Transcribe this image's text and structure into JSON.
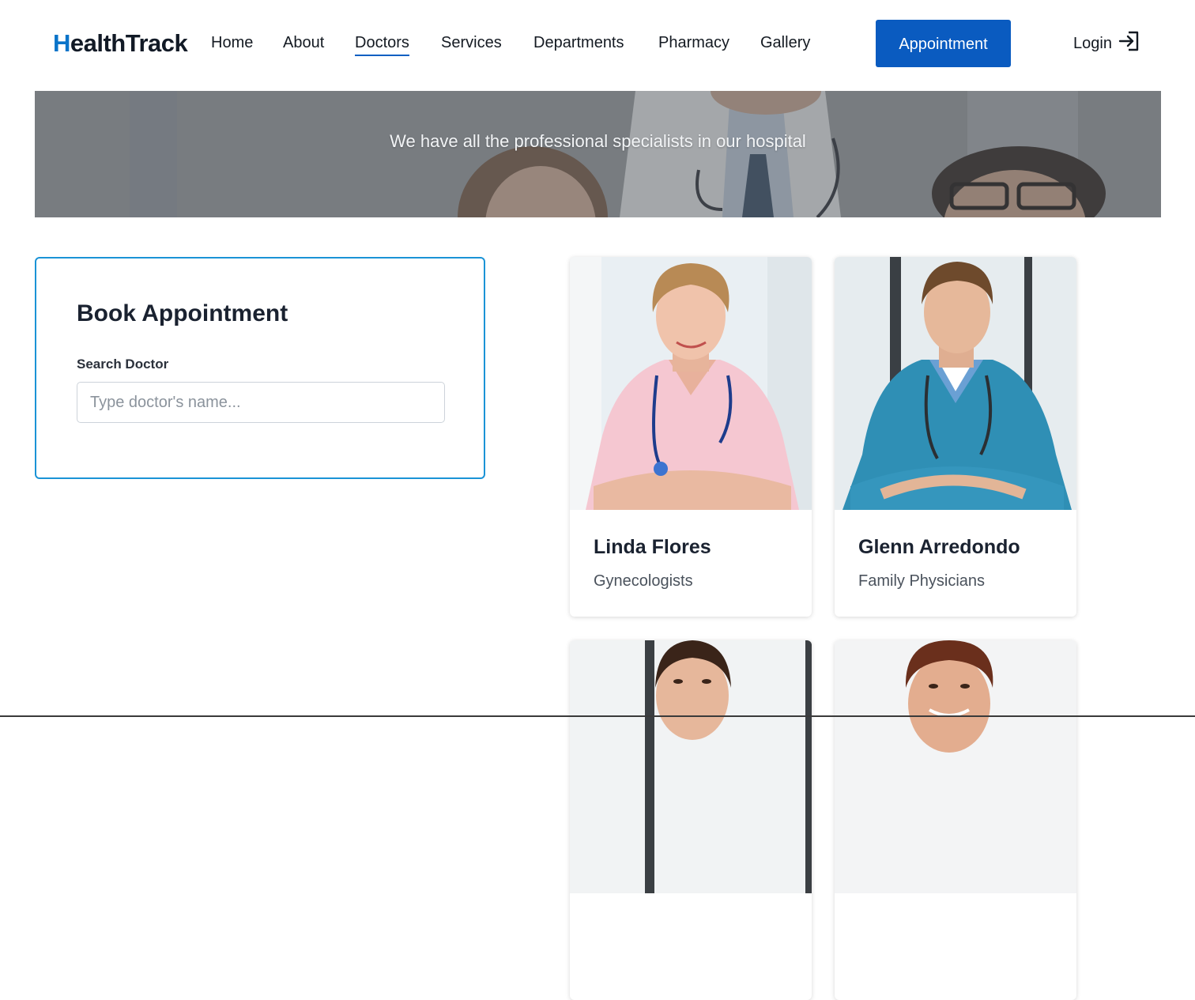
{
  "header": {
    "logo_initial": "H",
    "logo_rest": "ealthTrack",
    "nav": [
      {
        "label": "Home",
        "active": false
      },
      {
        "label": "About",
        "active": false
      },
      {
        "label": "Doctors",
        "active": true
      },
      {
        "label": "Services",
        "active": false
      },
      {
        "label": "Departments",
        "active": false
      },
      {
        "label": "Pharmacy",
        "active": false
      },
      {
        "label": "Gallery",
        "active": false
      }
    ],
    "appointment_label": "Appointment",
    "login_label": "Login",
    "login_icon": "login-arrow-icon"
  },
  "hero": {
    "tagline": "We have all the professional specialists in our hospital"
  },
  "booking": {
    "title": "Book Appointment",
    "search_label": "Search Doctor",
    "search_placeholder": "Type doctor's name...",
    "search_value": ""
  },
  "doctors": [
    {
      "name": "Linda Flores",
      "specialty": "Gynecologists",
      "scrub_color": "#f4c6cf",
      "hair_color": "#b88a55"
    },
    {
      "name": "Glenn Arredondo",
      "specialty": "Family Physicians",
      "scrub_color": "#2f8fb5",
      "hair_color": "#6e4a2c"
    },
    {
      "name": "",
      "specialty": "",
      "scrub_color": "#ffffff",
      "hair_color": "#3a2419"
    },
    {
      "name": "",
      "specialty": "",
      "scrub_color": "#ffffff",
      "hair_color": "#6a2f1c"
    }
  ],
  "colors": {
    "brand": "#0a74c9",
    "button": "#0a5bc0",
    "card_border": "#1b93d6"
  }
}
